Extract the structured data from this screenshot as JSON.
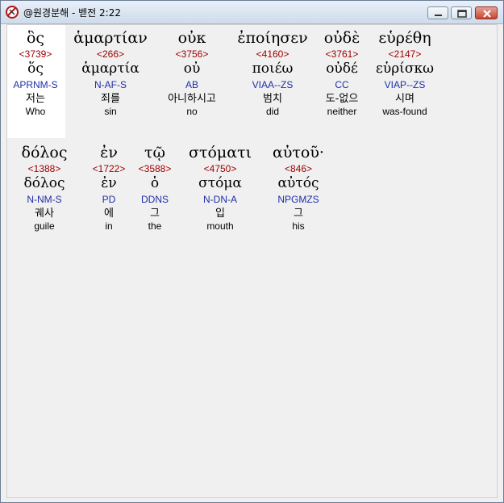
{
  "window": {
    "title": "@원경분해 - 벧전 2:22"
  },
  "colors": {
    "strong": "#a00000",
    "morph": "#1f2ea8",
    "text": "#000000"
  },
  "lines": [
    {
      "words": [
        {
          "greek": "ὃς",
          "strong": "<3739>",
          "lemma": "ὅς",
          "morph": "APRNM-S",
          "korean": "저는",
          "english": "Who"
        },
        {
          "greek": "ἁμαρτίαν",
          "strong": "<266>",
          "lemma": "ἁμαρτία",
          "morph": "N-AF-S",
          "korean": "죄를",
          "english": "sin"
        },
        {
          "greek": "οὐκ",
          "strong": "<3756>",
          "lemma": "οὐ",
          "morph": "AB",
          "korean": "아니하시고",
          "english": "no"
        },
        {
          "greek": "ἐποίησεν",
          "strong": "<4160>",
          "lemma": "ποιέω",
          "morph": "VIAA--ZS",
          "korean": "범치",
          "english": "did"
        },
        {
          "greek": "οὐδὲ",
          "strong": "<3761>",
          "lemma": "οὐδέ",
          "morph": "CC",
          "korean": "도-없으",
          "english": "neither"
        },
        {
          "greek": "εὑρέθη",
          "strong": "<2147>",
          "lemma": "εὑρίσκω",
          "morph": "VIAP--ZS",
          "korean": "시며",
          "english": "was-found"
        }
      ]
    },
    {
      "words": [
        {
          "greek": "δόλος",
          "strong": "<1388>",
          "lemma": "δόλος",
          "morph": "N-NM-S",
          "korean": "궤사",
          "english": "guile"
        },
        {
          "greek": "ἐν",
          "strong": "<1722>",
          "lemma": "ἐν",
          "morph": "PD",
          "korean": "에",
          "english": "in"
        },
        {
          "greek": "τῷ",
          "strong": "<3588>",
          "lemma": "ὁ",
          "morph": "DDNS",
          "korean": "그",
          "english": "the"
        },
        {
          "greek": "στόματι",
          "strong": "<4750>",
          "lemma": "στόμα",
          "morph": "N-DN-A",
          "korean": "입",
          "english": "mouth"
        },
        {
          "greek": "αὐτοῦ·",
          "strong": "<846>",
          "lemma": "αὐτός",
          "morph": "NPGMZS",
          "korean": "그",
          "english": "his"
        }
      ]
    }
  ]
}
